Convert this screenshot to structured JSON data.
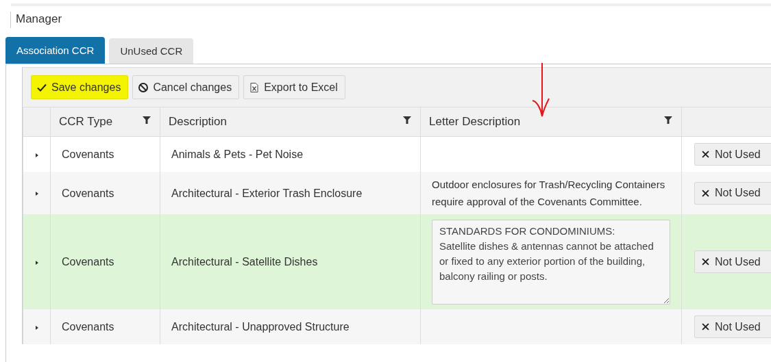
{
  "title": "Manager",
  "tabs": [
    {
      "label": "Association CCR",
      "selected": true
    },
    {
      "label": "UnUsed CCR",
      "selected": false
    }
  ],
  "toolbar": [
    {
      "kind": "save",
      "label": "Save changes",
      "highlighted": true
    },
    {
      "kind": "cancel",
      "label": "Cancel changes",
      "highlighted": false
    },
    {
      "kind": "excel",
      "label": "Export to Excel",
      "highlighted": false
    }
  ],
  "annotation": {
    "kind": "arrow"
  },
  "table": {
    "columns": [
      {
        "label": "CCR Type",
        "filter": true
      },
      {
        "label": "Description",
        "filter": true
      },
      {
        "label": "Letter Description",
        "filter": true
      }
    ],
    "rows": [
      {
        "ccr_type": "Covenants",
        "description": "Animals & Pets - Pet Noise",
        "action": "Not Used",
        "editing": false
      },
      {
        "ccr_type": "Covenants",
        "description": "Architectural - Exterior Trash Enclosure",
        "letter": "Outdoor enclosures for Trash/Recycling Containers require approval of the Covenants Committee.",
        "action": "Not Used",
        "editing": false
      },
      {
        "ccr_type": "Covenants",
        "description": "Architectural - Satellite Dishes",
        "letter": "STANDARDS FOR CONDOMINIUMS:\nSatellite dishes & antennas cannot be attached or fixed to any exterior portion of the building, balcony railing or posts.",
        "action": "Not Used",
        "editing": true
      },
      {
        "ccr_type": "Covenants",
        "description": "Architectural - Unapproved Structure",
        "action": "Not Used",
        "editing": false
      }
    ]
  }
}
